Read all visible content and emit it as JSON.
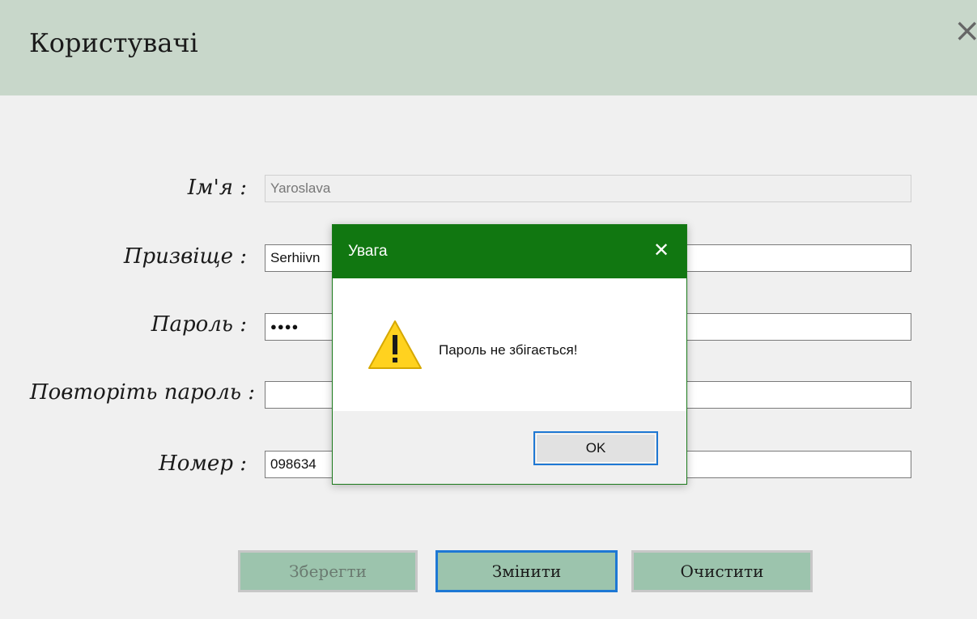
{
  "window": {
    "title": "Користувачі",
    "close_glyph": "×"
  },
  "form": {
    "name": {
      "label": "Ім'я :",
      "value": "Yaroslava"
    },
    "surname": {
      "label": "Призвіще :",
      "value": "Serhiivn"
    },
    "password": {
      "label": "Пароль :",
      "value": "●●●●"
    },
    "repeat_password": {
      "label": "Повторіть пароль :",
      "value": ""
    },
    "number": {
      "label": "Номер :",
      "value": "098634"
    }
  },
  "buttons": {
    "save": "Зберегти",
    "change": "Змінити",
    "clear": "Очистити"
  },
  "dialog": {
    "title": "Увага",
    "close_glyph": "✕",
    "message": "Пароль не збігається!",
    "ok_label": "OK",
    "icon": "warning-icon"
  },
  "colors": {
    "header_bg": "#c8d7ca",
    "dialog_titlebar": "#117711",
    "button_bg": "#9cc4ad",
    "focus": "#1e78d4"
  }
}
